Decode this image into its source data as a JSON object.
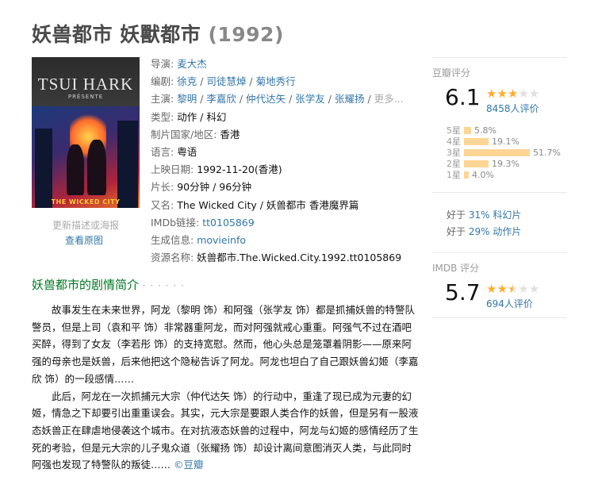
{
  "title": {
    "main": "妖兽都市 妖獸都市",
    "year": "(1992)"
  },
  "poster": {
    "director_text": "TSUI HARK",
    "presente": "PRÉSENTE",
    "tagline": "THE WICKED CITY",
    "small_link": "更新描述或海报",
    "view_link": "查看原图"
  },
  "info": {
    "director": {
      "label": "导演",
      "values": [
        "麦大杰"
      ]
    },
    "writers": {
      "label": "编剧",
      "values": [
        "徐克",
        "司徒慧焯",
        "菊地秀行"
      ]
    },
    "cast": {
      "label": "主演",
      "values": [
        "黎明",
        "李嘉欣",
        "仲代达矢",
        "张学友",
        "张耀扬"
      ],
      "more": "更多..."
    },
    "genre": {
      "label": "类型:",
      "value": "动作 / 科幻"
    },
    "country": {
      "label": "制片国家/地区:",
      "value": "香港"
    },
    "language": {
      "label": "语言:",
      "value": "粤语"
    },
    "release": {
      "label": "上映日期:",
      "value": "1992-11-20(香港)"
    },
    "runtime": {
      "label": "片长:",
      "value": "90分钟 / 96分钟"
    },
    "aka": {
      "label": "又名:",
      "value": "The Wicked City / 妖兽都市 香港魔界篇"
    },
    "imdb": {
      "label": "IMDb链接:",
      "value": "tt0105869"
    },
    "gen": {
      "label": "生成信息:",
      "value": "movieinfo"
    },
    "resource": {
      "label": "资源名称:",
      "value": "妖兽都市.The.Wicked.City.1992.tt0105869"
    }
  },
  "douban": {
    "label": "豆瓣评分",
    "score": "6.1",
    "stars_filled": 3,
    "stars_total": 5,
    "count": "8458人评价",
    "distribution": [
      {
        "label": "5星",
        "pct": "5.8%",
        "value": 5.8
      },
      {
        "label": "4星",
        "pct": "19.1%",
        "value": 19.1
      },
      {
        "label": "3星",
        "pct": "51.7%",
        "value": 51.7
      },
      {
        "label": "2星",
        "pct": "19.3%",
        "value": 19.3
      },
      {
        "label": "1星",
        "pct": "4.0%",
        "value": 4.0
      }
    ],
    "compare": [
      {
        "prefix": "好于",
        "pct": "31%",
        "genre": "科幻片"
      },
      {
        "prefix": "好于",
        "pct": "29%",
        "genre": "动作片"
      }
    ]
  },
  "imdb_rating": {
    "label": "IMDB 评分",
    "score": "5.7",
    "stars_filled": 2.5,
    "stars_total": 5,
    "count": "694人评价"
  },
  "summary": {
    "title": "妖兽都市的剧情简介",
    "dots": "· · · · · ·",
    "paragraphs": [
      "故事发生在未来世界，阿龙（黎明 饰）和阿强（张学友 饰）都是抓捕妖兽的特警队警员，但是上司（袁和平 饰）非常器重阿龙，而对阿强就戒心重重。阿强气不过在酒吧买醉，得到了女友（李若彤 饰）的支持宽慰。然而，他心头总是笼罩着阴影——原来阿强的母亲也是妖兽，后来他把这个隐秘告诉了阿龙。阿龙也坦白了自己跟妖兽幻姬（李嘉欣 饰）的一段感情……",
      "此后，阿龙在一次抓捕元大宗（仲代达矢 饰）的行动中，重逢了现已成为元妻的幻姬，情急之下却要引出重重误会。其实，元大宗是要跟人类合作的妖兽，但是另有一股液态妖兽正在肆虐地侵袭这个城市。在对抗液态妖兽的过程中，阿龙与幻姬的感情经历了生死的考验，但是元大宗的儿子鬼众道（张耀扬 饰）却设计离间意图消灭人类，与此同时阿强也发现了特警队的叛徒……"
    ],
    "credit": "©豆瓣"
  }
}
